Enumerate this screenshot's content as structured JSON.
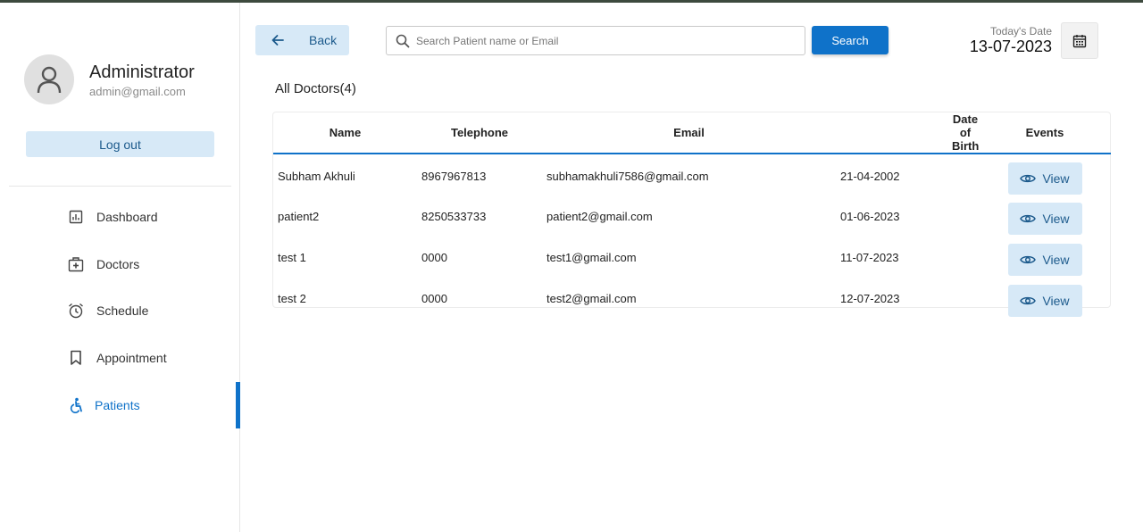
{
  "sidebar": {
    "user": {
      "name": "Administrator",
      "email": "admin@gmail.com"
    },
    "logout_label": "Log out",
    "items": [
      {
        "label": "Dashboard",
        "icon": "dashboard-icon"
      },
      {
        "label": "Doctors",
        "icon": "medical-bag-icon"
      },
      {
        "label": "Schedule",
        "icon": "alarm-clock-icon"
      },
      {
        "label": "Appointment",
        "icon": "bookmark-icon"
      },
      {
        "label": "Patients",
        "icon": "accessible-person-icon",
        "active": true
      }
    ]
  },
  "header": {
    "back_label": "Back",
    "search": {
      "placeholder": "Search Patient name or Email",
      "value": "",
      "button_label": "Search"
    },
    "date_label": "Today's Date",
    "date_value": "13-07-2023"
  },
  "main": {
    "title": "All Doctors(4)",
    "columns": [
      "Name",
      "Telephone",
      "Email",
      "Date of Birth",
      "Events"
    ],
    "rows": [
      {
        "name": "Subham Akhuli",
        "telephone": "8967967813",
        "email": "subhamakhuli7586@gmail.com",
        "dob": "21-04-2002",
        "action": "View"
      },
      {
        "name": "patient2",
        "telephone": "8250533733",
        "email": "patient2@gmail.com",
        "dob": "01-06-2023",
        "action": "View"
      },
      {
        "name": "test 1",
        "telephone": "0000",
        "email": "test1@gmail.com",
        "dob": "11-07-2023",
        "action": "View"
      },
      {
        "name": "test 2",
        "telephone": "0000",
        "email": "test2@gmail.com",
        "dob": "12-07-2023",
        "action": "View"
      }
    ]
  },
  "colors": {
    "accent": "#0f72c9",
    "accent_light": "#d7e9f7",
    "accent_text": "#1c5a8c"
  }
}
